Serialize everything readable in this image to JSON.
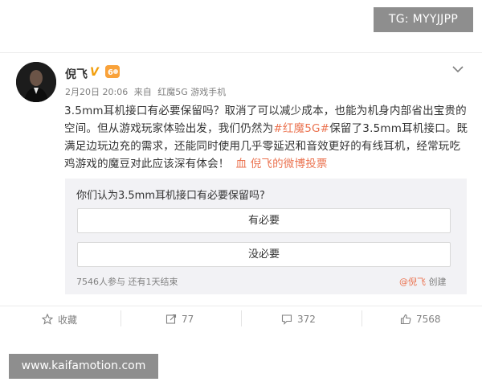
{
  "watermarks": {
    "tg": "TG: MYYJJPP",
    "site": "www.kaifamotion.com"
  },
  "post": {
    "username": "倪飞",
    "verified_mark": "V",
    "date": "2月20日 20:06",
    "source_prefix": "来自",
    "source": "红魔5G 游戏手机",
    "text_part1": "3.5mm耳机接口有必要保留吗？取消了可以减少成本，也能为机身内部省出宝贵的空间。但从游戏玩家体验出发，我们仍然为",
    "hashtag": "#红魔5G#",
    "text_part2": "保留了3.5mm耳机接口。既满足边玩边充的需求，还能同时使用几乎零延迟和音效更好的有线耳机，经常玩吃鸡游戏的魔豆对此应该深有体会！",
    "vote_link_icon": "血",
    "vote_link_text": "倪飞的微博投票"
  },
  "vote": {
    "question": "你们认为3.5mm耳机接口有必要保留吗?",
    "options": [
      "有必要",
      "没必要"
    ],
    "stats": "7546人参与 还有1天结束",
    "creator_user": "@倪飞",
    "creator_suffix": " 创建"
  },
  "actions": {
    "favorite_label": "收藏",
    "repost_count": "77",
    "comment_count": "372",
    "like_count": "7568"
  },
  "colors": {
    "accent": "#eb7350",
    "verified": "#f29e0b",
    "muted": "#808080",
    "vote_bg": "#f2f2f5"
  }
}
